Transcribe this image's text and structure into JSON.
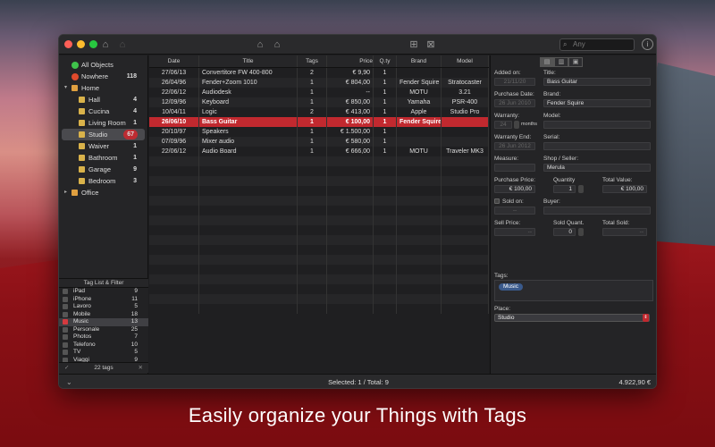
{
  "caption": "Easily organize your Things with Tags",
  "toolbar": {
    "search_placeholder": "Any",
    "search_icon": "magnifier-icon",
    "info_icon": "info-icon"
  },
  "sidebar": {
    "all": {
      "label": "All Objects"
    },
    "nowhere": {
      "label": "Nowhere",
      "count": "118"
    },
    "home": {
      "label": "Home"
    },
    "rooms": [
      {
        "label": "Hall",
        "count": "4"
      },
      {
        "label": "Cucina",
        "count": "4"
      },
      {
        "label": "Living Room",
        "count": "1"
      },
      {
        "label": "Studio",
        "count": "67"
      },
      {
        "label": "Waiver",
        "count": "1"
      },
      {
        "label": "Bathroom",
        "count": "1"
      },
      {
        "label": "Garage",
        "count": "9"
      },
      {
        "label": "Bedroom",
        "count": "3"
      }
    ],
    "office": {
      "label": "Office"
    }
  },
  "tags": {
    "header": "Tag List & Filter",
    "items": [
      {
        "label": "iPad",
        "count": "9",
        "checked": false
      },
      {
        "label": "iPhone",
        "count": "11",
        "checked": false
      },
      {
        "label": "Lavoro",
        "count": "5",
        "checked": false
      },
      {
        "label": "Mobile",
        "count": "18",
        "checked": false
      },
      {
        "label": "Music",
        "count": "13",
        "checked": true
      },
      {
        "label": "Personale",
        "count": "25",
        "checked": false
      },
      {
        "label": "Photos",
        "count": "7",
        "checked": false
      },
      {
        "label": "Telefono",
        "count": "10",
        "checked": false
      },
      {
        "label": "TV",
        "count": "5",
        "checked": false
      },
      {
        "label": "Viaggi",
        "count": "9",
        "checked": false
      }
    ],
    "footer": "22 tags"
  },
  "table": {
    "headers": [
      "Date",
      "Title",
      "Tags",
      "Price",
      "Q.ty",
      "Brand",
      "Model"
    ],
    "rows": [
      [
        "27/06/13",
        "Convertitore FW 400-800",
        "2",
        "€ 9,90",
        "1",
        "",
        ""
      ],
      [
        "26/04/96",
        "Fender+Zoom 1010",
        "1",
        "€ 804,00",
        "1",
        "Fender Squire",
        "Stratocaster"
      ],
      [
        "22/06/12",
        "Audiodesk",
        "1",
        "--",
        "1",
        "MOTU",
        "3.21"
      ],
      [
        "12/09/96",
        "Keyboard",
        "1",
        "€ 850,00",
        "1",
        "Yamaha",
        "PSR-400"
      ],
      [
        "10/04/11",
        "Logic",
        "2",
        "€ 413,00",
        "1",
        "Apple",
        "Studio Pro"
      ],
      [
        "26/06/10",
        "Bass Guitar",
        "1",
        "€ 100,00",
        "1",
        "Fender Squire",
        ""
      ],
      [
        "20/10/97",
        "Speakers",
        "1",
        "€ 1.500,00",
        "1",
        "",
        ""
      ],
      [
        "07/09/96",
        "Mixer audio",
        "1",
        "€ 580,00",
        "1",
        "",
        ""
      ],
      [
        "22/06/12",
        "Audio Board",
        "1",
        "€ 666,00",
        "1",
        "MOTU",
        "Traveler MK3"
      ]
    ],
    "selected_index": 5
  },
  "detail": {
    "added_on_label": "Added on:",
    "added_on": "21/11/20",
    "title_label": "Title:",
    "title": "Bass Guitar",
    "purchase_date_label": "Purchase Date:",
    "purchase_date": "26 Jun 2010",
    "brand_label": "Brand:",
    "brand": "Fender Squire",
    "warranty_label": "Warranty:",
    "warranty": "24",
    "warranty_unit": "months",
    "model_label": "Model:",
    "warranty_end_label": "Warranty End:",
    "warranty_end": "26 Jun 2012",
    "serial_label": "Serial:",
    "measure_label": "Measure:",
    "shop_label": "Shop / Seller:",
    "shop": "Merula",
    "purchase_price_label": "Purchase Price:",
    "purchase_price": "€ 100,00",
    "quantity_label": "Quantity",
    "quantity": "1",
    "total_value_label": "Total Value:",
    "total_value": "€ 100,00",
    "sold_on_label": "Sold on:",
    "sold_on": "--",
    "buyer_label": "Buyer:",
    "sell_price_label": "Sell Price:",
    "sell_price": "--",
    "sold_quant_label": "Sold Quant.",
    "sold_quant": "0",
    "total_sold_label": "Total Sold:",
    "total_sold": "--",
    "tags_label": "Tags:",
    "tag_chip": "Music",
    "place_label": "Place:",
    "place": "Studio"
  },
  "status": {
    "selection": "Selected: 1 / Total: 9",
    "total": "4.922,90 €"
  },
  "colors": {
    "accent": "#c1292f",
    "window_bg": "#1e1e20"
  }
}
